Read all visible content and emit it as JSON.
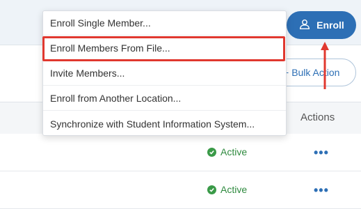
{
  "header": {
    "enroll_label": "Enroll",
    "enroll_icon": "user-icon"
  },
  "toolbar": {
    "bulk_action_label": "Bulk Action",
    "bulk_action_prefix": "+"
  },
  "table": {
    "actions_header": "Actions",
    "rows": [
      {
        "status": "Active",
        "actions_icon": "more-horizontal-icon"
      },
      {
        "status": "Active",
        "actions_icon": "more-horizontal-icon"
      }
    ]
  },
  "enroll_menu": {
    "items": [
      "Enroll Single Member...",
      "Enroll Members From File...",
      "Invite Members...",
      "Enroll from Another Location...",
      "Synchronize with Student Information System..."
    ],
    "highlighted_index": 1
  },
  "annotation": {
    "highlight_color": "#e0382f",
    "arrow_color": "#e0382f"
  },
  "colors": {
    "primary": "#2d6fb5",
    "success": "#3a9a48"
  }
}
